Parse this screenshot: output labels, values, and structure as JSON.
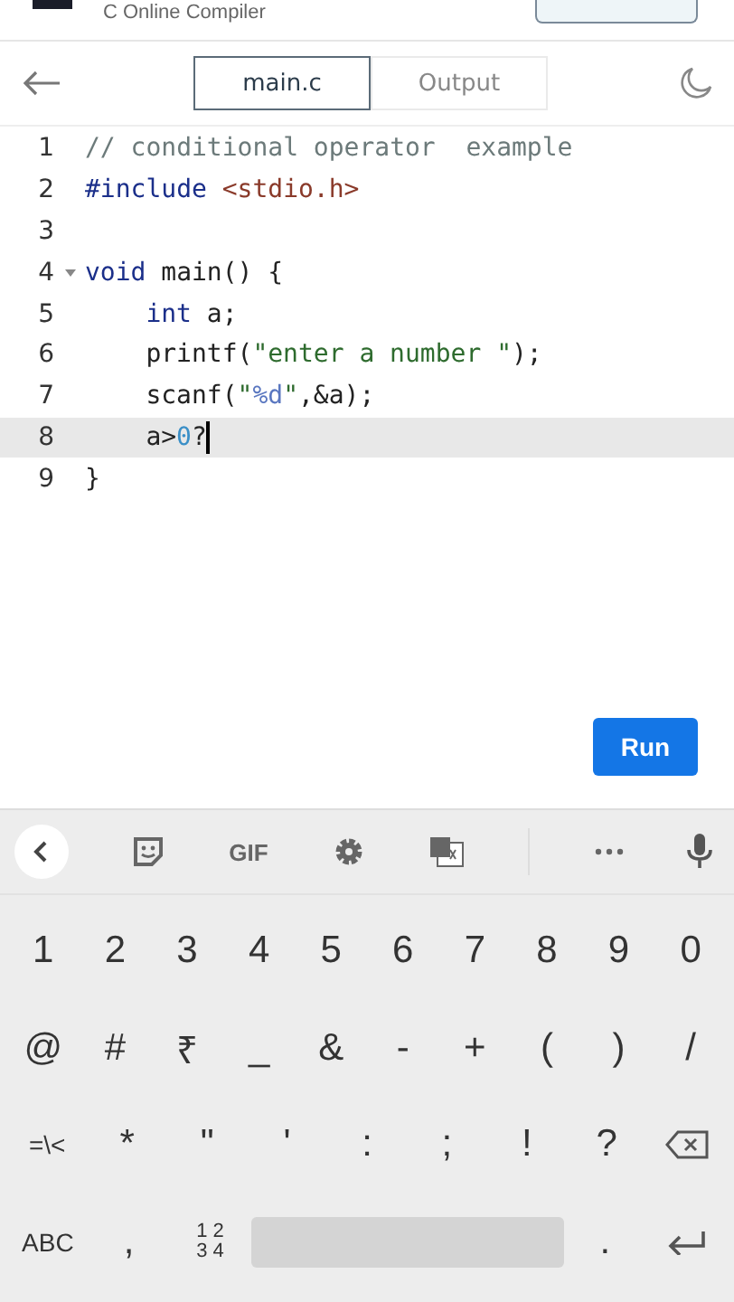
{
  "header": {
    "subtitle": "C Online Compiler"
  },
  "toolbar": {
    "tabs": [
      {
        "label": "main.c",
        "selected": true
      },
      {
        "label": "Output",
        "selected": false
      }
    ]
  },
  "editor": {
    "lines": [
      {
        "number": "1",
        "selected": false,
        "tokens": [
          {
            "kind": "comment",
            "text": "// conditional operator  example"
          }
        ]
      },
      {
        "number": "2",
        "selected": false,
        "tokens": [
          {
            "kind": "include",
            "text": "#include "
          },
          {
            "kind": "header",
            "text": "<stdio.h>"
          }
        ]
      },
      {
        "number": "3",
        "selected": false
      },
      {
        "number": "4",
        "foldable": true,
        "selected": false,
        "tokens": [
          {
            "kind": "keyword",
            "text": "void"
          },
          {
            "kind": "plain",
            "text": " main() {"
          }
        ]
      },
      {
        "number": "5",
        "indented": true,
        "selected": false,
        "tokens": [
          {
            "kind": "keyword",
            "text": "int"
          },
          {
            "kind": "plain",
            "text": " a;"
          }
        ]
      },
      {
        "number": "6",
        "indented": true,
        "selected": false,
        "tokens": [
          {
            "kind": "plain",
            "text": "printf("
          },
          {
            "kind": "string",
            "text": "\"enter a number \""
          },
          {
            "kind": "plain",
            "text": ");"
          }
        ]
      },
      {
        "number": "7",
        "indented": true,
        "selected": false,
        "tokens": [
          {
            "kind": "plain",
            "text": "scanf("
          },
          {
            "kind": "string",
            "text": "\""
          },
          {
            "kind": "format",
            "text": "%d"
          },
          {
            "kind": "string",
            "text": "\""
          },
          {
            "kind": "plain",
            "text": ",&a);"
          }
        ]
      },
      {
        "number": "8",
        "indented": true,
        "selected": true,
        "cursor": true,
        "tokens": [
          {
            "kind": "plain",
            "text": "a>"
          },
          {
            "kind": "number",
            "text": "0"
          },
          {
            "kind": "plain",
            "text": "?"
          }
        ]
      },
      {
        "number": "9",
        "selected": false,
        "tokens": [
          {
            "kind": "plain",
            "text": "}"
          }
        ]
      }
    ]
  },
  "run_button": {
    "label": "Run"
  },
  "keyboard": {
    "toolbar": [
      {
        "kind": "back"
      },
      {
        "kind": "sticker"
      },
      {
        "kind": "gif",
        "text": "GIF"
      },
      {
        "kind": "settings"
      },
      {
        "kind": "translate"
      },
      {
        "kind": "more"
      },
      {
        "kind": "mic"
      }
    ],
    "rows": [
      [
        {
          "kind": "char",
          "label": "1"
        },
        {
          "kind": "char",
          "label": "2"
        },
        {
          "kind": "char",
          "label": "3"
        },
        {
          "kind": "char",
          "label": "4"
        },
        {
          "kind": "char",
          "label": "5"
        },
        {
          "kind": "char",
          "label": "6"
        },
        {
          "kind": "char",
          "label": "7"
        },
        {
          "kind": "char",
          "label": "8"
        },
        {
          "kind": "char",
          "label": "9"
        },
        {
          "kind": "char",
          "label": "0"
        }
      ],
      [
        {
          "kind": "char",
          "label": "@"
        },
        {
          "kind": "char",
          "label": "#"
        },
        {
          "kind": "char",
          "label": "₹"
        },
        {
          "kind": "char",
          "label": "_"
        },
        {
          "kind": "char",
          "label": "&"
        },
        {
          "kind": "char",
          "label": "-"
        },
        {
          "kind": "char",
          "label": "+"
        },
        {
          "kind": "char",
          "label": "("
        },
        {
          "kind": "char",
          "label": ")"
        },
        {
          "kind": "char",
          "label": "/"
        }
      ],
      [
        {
          "kind": "small",
          "label": "=\\<"
        },
        {
          "kind": "char",
          "label": "*"
        },
        {
          "kind": "char",
          "label": "\""
        },
        {
          "kind": "char",
          "label": "'"
        },
        {
          "kind": "char",
          "label": ":"
        },
        {
          "kind": "char",
          "label": ";"
        },
        {
          "kind": "char",
          "label": "!"
        },
        {
          "kind": "char",
          "label": "?"
        },
        {
          "kind": "backspace"
        }
      ],
      [
        {
          "kind": "small",
          "label": "ABC"
        },
        {
          "kind": "char",
          "label": ","
        },
        {
          "kind": "numpad",
          "top": "1 2",
          "bottom": "3 4"
        },
        {
          "kind": "space"
        },
        {
          "kind": "char",
          "label": "."
        },
        {
          "kind": "enter"
        }
      ]
    ]
  }
}
